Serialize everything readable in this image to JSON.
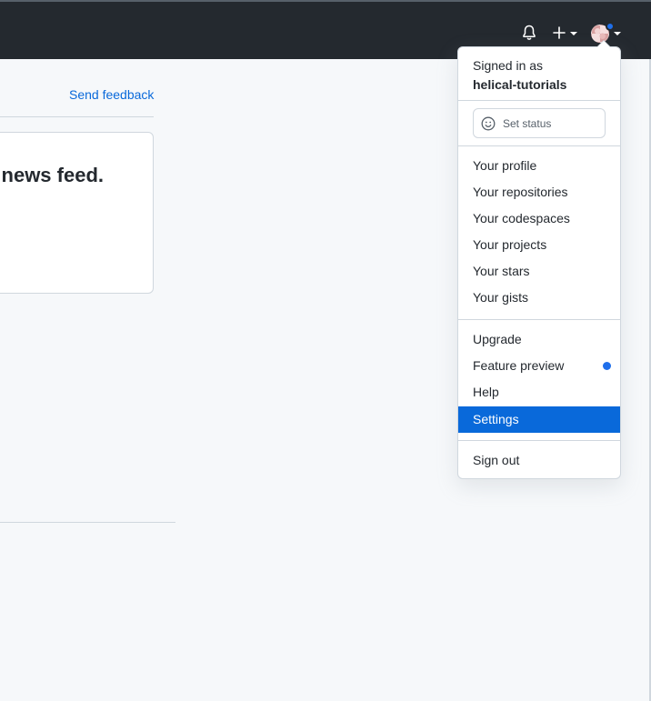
{
  "header": {
    "notifications_icon": "bell-icon",
    "create_icon": "plus-icon",
    "avatar_icon": "avatar"
  },
  "main": {
    "send_feedback": "Send feedback",
    "card_title": "news feed."
  },
  "menu": {
    "signed_in_label": "Signed in as",
    "username": "helical-tutorials",
    "set_status": "Set status",
    "profile_items": [
      "Your profile",
      "Your repositories",
      "Your codespaces",
      "Your projects",
      "Your stars",
      "Your gists"
    ],
    "upgrade": "Upgrade",
    "feature_preview": "Feature preview",
    "help": "Help",
    "settings": "Settings",
    "sign_out": "Sign out"
  },
  "colors": {
    "header_bg": "#24292f",
    "accent": "#0969da",
    "dot": "#1f6feb",
    "page_bg": "#f6f8fa"
  }
}
